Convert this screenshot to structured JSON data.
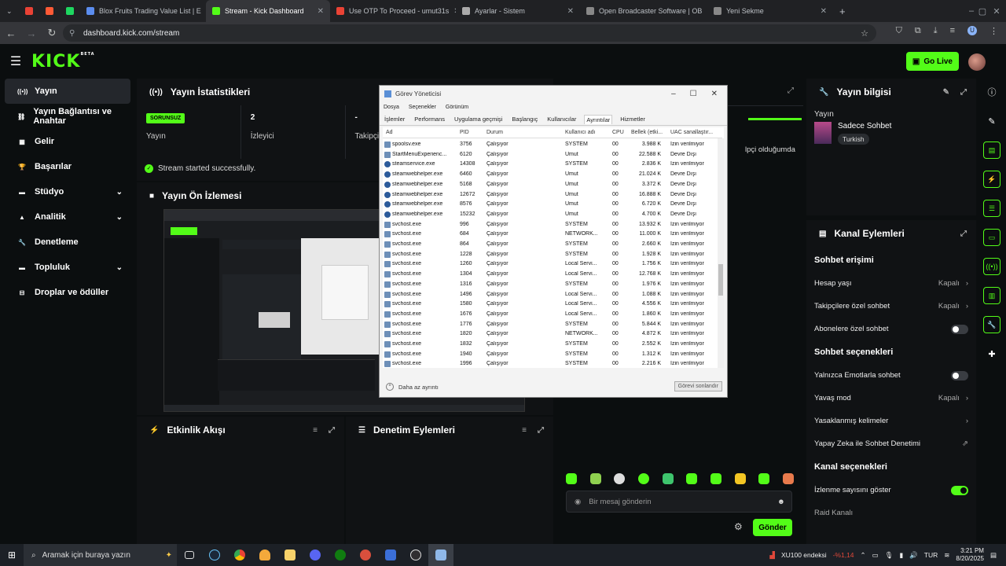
{
  "browser": {
    "tabs": [
      {
        "label": "",
        "color": "#e94235"
      },
      {
        "label": "",
        "color": "#ff5a36"
      },
      {
        "label": "",
        "color": "#1ed760"
      },
      {
        "label": "Blox Fruits Trading Value List | E",
        "color": "#5b8def"
      },
      {
        "label": "Stream - Kick Dashboard",
        "color": "#53fc18",
        "active": true
      },
      {
        "label": "Use OTP To Proceed - umut31s",
        "color": "#ea4335"
      },
      {
        "label": "Ayarlar - Sistem",
        "color": "#aaaaaa"
      },
      {
        "label": "Open Broadcaster Software | OB",
        "color": "#888888"
      },
      {
        "label": "Yeni Sekme",
        "color": "#888888"
      }
    ],
    "url": "dashboard.kick.com/stream"
  },
  "header": {
    "logo": "KICK",
    "logo_sup": "BETA",
    "go_live": "Go Live"
  },
  "sidebar": {
    "items": [
      {
        "label": "Yayın",
        "icon": "broadcast-icon",
        "active": true
      },
      {
        "label": "Yayın Bağlantısı ve Anahtar",
        "icon": "link-icon"
      },
      {
        "label": "Gelir",
        "icon": "money-icon"
      },
      {
        "label": "Başarılar",
        "icon": "trophy-icon"
      },
      {
        "label": "Stüdyo",
        "icon": "studio-icon",
        "chevron": true
      },
      {
        "label": "Analitik",
        "icon": "chart-icon",
        "chevron": true
      },
      {
        "label": "Denetleme",
        "icon": "wrench-icon"
      },
      {
        "label": "Topluluk",
        "icon": "community-icon",
        "chevron": true
      },
      {
        "label": "Droplar ve ödüller",
        "icon": "gift-icon"
      }
    ]
  },
  "stats_panel": {
    "title": "Yayın İstatistikleri",
    "status_badge": "SORUNSUZ",
    "stream_label": "Yayın",
    "viewers_value": "2",
    "viewers_label": "İzleyici",
    "followers_value": "-",
    "followers_label": "Takipçi",
    "success_message": "Stream started successfully."
  },
  "preview_panel": {
    "title": "Yayın Ön İzlemesi"
  },
  "activity_panel": {
    "title": "Etkinlik Akışı"
  },
  "moderation_panel": {
    "title": "Denetim Eylemleri"
  },
  "chat_partial": {
    "fragment": "lpçi olduğumda",
    "input_placeholder": "Bir mesaj gönderin",
    "send_label": "Gönder"
  },
  "stream_info": {
    "title": "Yayın bilgisi",
    "label": "Yayın",
    "stream_title": "Sadece Sohbet",
    "language_tag": "Turkish"
  },
  "channel_actions": {
    "title": "Kanal Eylemleri",
    "chat_access_heading": "Sohbet erişimi",
    "account_age_label": "Hesap yaşı",
    "account_age_value": "Kapalı",
    "followers_only_label": "Takipçilere özel sohbet",
    "followers_only_value": "Kapalı",
    "subscribers_only_label": "Abonelere özel sohbet",
    "subscribers_only_on": false,
    "chat_options_heading": "Sohbet seçenekleri",
    "emotes_only_label": "Yalnızca Emotlarla sohbet",
    "emotes_only_on": false,
    "slow_mode_label": "Yavaş mod",
    "slow_mode_value": "Kapalı",
    "banned_words_label": "Yasaklanmış kelimeler",
    "ai_moderation_label": "Yapay Zeka ile Sohbet Denetimi",
    "channel_options_heading": "Kanal seçenekleri",
    "show_viewers_label": "İzlenme sayısını göster",
    "show_viewers_on": true,
    "raid_label": "Raid Kanalı"
  },
  "task_manager": {
    "title": "Görev Yöneticisi",
    "menu": [
      "Dosya",
      "Seçenekler",
      "Görünüm"
    ],
    "tabs": [
      "İşlemler",
      "Performans",
      "Uygulama geçmişi",
      "Başlangıç",
      "Kullanıcılar",
      "Ayrıntılar",
      "Hizmetler"
    ],
    "active_tab": "Ayrıntılar",
    "columns": [
      "Ad",
      "PID",
      "Durum",
      "Kullanıcı adı",
      "CPU",
      "Bellek (etki...",
      "UAC sanallaştır..."
    ],
    "rows": [
      [
        "spoolsv.exe",
        "3756",
        "Çalışıyor",
        "SYSTEM",
        "00",
        "3.988 K",
        "İzin verilmiyor"
      ],
      [
        "StartMenuExperienc...",
        "6120",
        "Çalışıyor",
        "Umut",
        "00",
        "22.588 K",
        "Devre Dışı"
      ],
      [
        "steamservice.exe",
        "14308",
        "Çalışıyor",
        "SYSTEM",
        "00",
        "2.836 K",
        "İzin verilmiyor"
      ],
      [
        "steamwebhelper.exe",
        "6460",
        "Çalışıyor",
        "Umut",
        "00",
        "21.024 K",
        "Devre Dışı"
      ],
      [
        "steamwebhelper.exe",
        "5168",
        "Çalışıyor",
        "Umut",
        "00",
        "3.372 K",
        "Devre Dışı"
      ],
      [
        "steamwebhelper.exe",
        "12672",
        "Çalışıyor",
        "Umut",
        "00",
        "16.888 K",
        "Devre Dışı"
      ],
      [
        "steamwebhelper.exe",
        "8576",
        "Çalışıyor",
        "Umut",
        "00",
        "6.720 K",
        "Devre Dışı"
      ],
      [
        "steamwebhelper.exe",
        "15232",
        "Çalışıyor",
        "Umut",
        "00",
        "4.700 K",
        "Devre Dışı"
      ],
      [
        "svchost.exe",
        "996",
        "Çalışıyor",
        "SYSTEM",
        "00",
        "13.932 K",
        "İzin verilmiyor"
      ],
      [
        "svchost.exe",
        "684",
        "Çalışıyor",
        "NETWORK...",
        "00",
        "11.000 K",
        "İzin verilmiyor"
      ],
      [
        "svchost.exe",
        "864",
        "Çalışıyor",
        "SYSTEM",
        "00",
        "2.660 K",
        "İzin verilmiyor"
      ],
      [
        "svchost.exe",
        "1228",
        "Çalışıyor",
        "SYSTEM",
        "00",
        "1.928 K",
        "İzin verilmiyor"
      ],
      [
        "svchost.exe",
        "1260",
        "Çalışıyor",
        "Local Servi...",
        "00",
        "1.756 K",
        "İzin verilmiyor"
      ],
      [
        "svchost.exe",
        "1304",
        "Çalışıyor",
        "Local Servi...",
        "00",
        "12.768 K",
        "İzin verilmiyor"
      ],
      [
        "svchost.exe",
        "1316",
        "Çalışıyor",
        "SYSTEM",
        "00",
        "1.976 K",
        "İzin verilmiyor"
      ],
      [
        "svchost.exe",
        "1496",
        "Çalışıyor",
        "Local Servi...",
        "00",
        "1.088 K",
        "İzin verilmiyor"
      ],
      [
        "svchost.exe",
        "1580",
        "Çalışıyor",
        "Local Servi...",
        "00",
        "4.556 K",
        "İzin verilmiyor"
      ],
      [
        "svchost.exe",
        "1676",
        "Çalışıyor",
        "Local Servi...",
        "00",
        "1.860 K",
        "İzin verilmiyor"
      ],
      [
        "svchost.exe",
        "1776",
        "Çalışıyor",
        "SYSTEM",
        "00",
        "5.844 K",
        "İzin verilmiyor"
      ],
      [
        "svchost.exe",
        "1820",
        "Çalışıyor",
        "NETWORK...",
        "00",
        "4.872 K",
        "İzin verilmiyor"
      ],
      [
        "svchost.exe",
        "1832",
        "Çalışıyor",
        "SYSTEM",
        "00",
        "2.552 K",
        "İzin verilmiyor"
      ],
      [
        "svchost.exe",
        "1940",
        "Çalışıyor",
        "SYSTEM",
        "00",
        "1.312 K",
        "İzin verilmiyor"
      ],
      [
        "svchost.exe",
        "1996",
        "Çalışıyor",
        "SYSTEM",
        "00",
        "2.216 K",
        "İzin verilmiyor"
      ]
    ],
    "fewer_details": "Daha az ayrıntı",
    "end_task": "Görevi sonlandır"
  },
  "taskbar": {
    "search_placeholder": "Aramak için buraya yazın",
    "ticker_name": "XU100 endeksi",
    "ticker_change": "-%1,14",
    "language": "TUR",
    "time": "3:21 PM",
    "date": "8/20/2025"
  },
  "colors": {
    "accent": "#53fc18",
    "panel": "#101214",
    "background": "#0b0e0f"
  }
}
